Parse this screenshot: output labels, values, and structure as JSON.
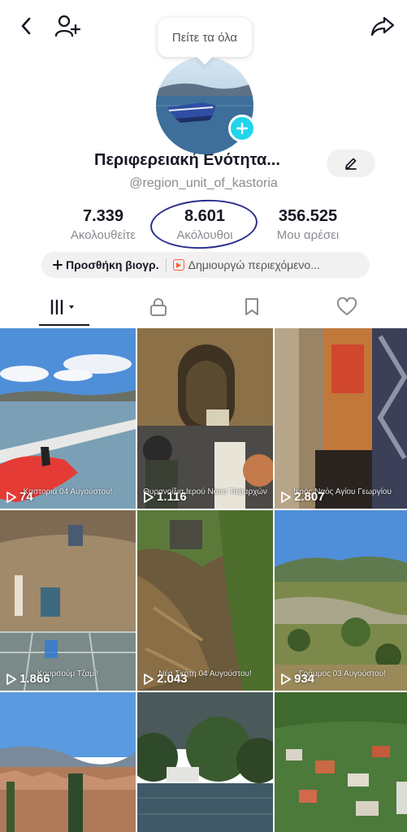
{
  "header": {
    "back_icon": "chevron-left-icon",
    "add_friend_icon": "person-add-icon",
    "share_icon": "share-arrow-icon"
  },
  "tooltip": {
    "text": "Πείτε τα όλα"
  },
  "profile": {
    "name": "Περιφερειακή Ενότητα...",
    "username": "@region_unit_of_kastoria"
  },
  "stats": {
    "following": {
      "value": "7.339",
      "label": "Ακολουθείτε"
    },
    "followers": {
      "value": "8.601",
      "label": "Ακόλουθοι"
    },
    "likes": {
      "value": "356.525",
      "label": "Μου αρέσει"
    }
  },
  "bio": {
    "add_label": "Προσθήκη βιογρ.",
    "creator_label": "Δημιουργώ περιεχόμενο..."
  },
  "tabs": [
    {
      "name": "videos",
      "icon": "grid-icon"
    },
    {
      "name": "private",
      "icon": "lock-icon"
    },
    {
      "name": "saved",
      "icon": "bookmark-icon"
    },
    {
      "name": "liked",
      "icon": "heart-icon"
    }
  ],
  "videos": [
    {
      "views": "74",
      "caption": "Καστοριά 04 Αυγούστου!"
    },
    {
      "views": "1.116",
      "caption": "Θυρανοίξια Ιερού Ναού Ταξιαρχών"
    },
    {
      "views": "2.807",
      "caption": "Ιερός Ναός Αγίου Γεωργίου"
    },
    {
      "views": "1.866",
      "caption": "Κουρσούμ Τζαμί!"
    },
    {
      "views": "2.043",
      "caption": "Νέα Σκήτη 04 Αυγούστου!"
    },
    {
      "views": "934",
      "caption": "Γράμμος 03 Αυγούστου!"
    },
    {
      "views": "",
      "caption": ""
    },
    {
      "views": "",
      "caption": ""
    },
    {
      "views": "",
      "caption": ""
    }
  ],
  "colors": {
    "accent": "#20d5ec",
    "text": "#161823",
    "secondary_text": "#8a8b91",
    "annotation": "#2b2f8f",
    "creator_icon": "#fe5f2f"
  }
}
